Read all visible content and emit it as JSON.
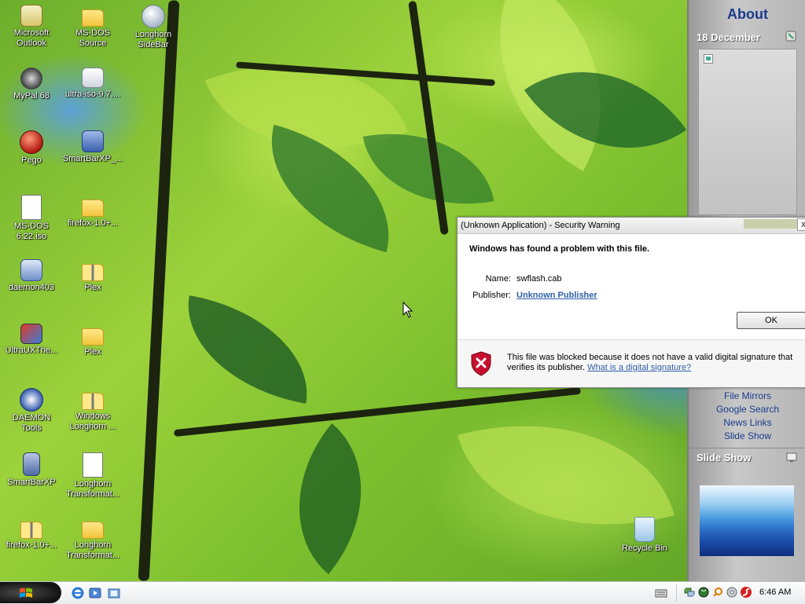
{
  "desktop": {
    "icons": [
      {
        "label": "Microsoft Outlook",
        "line1": "Microsoft",
        "line2": "Outlook",
        "icon": "outlook-icon"
      },
      {
        "label": "MS-DOS Source",
        "line1": "MS-DOS",
        "line2": "Source",
        "icon": "folder-icon"
      },
      {
        "label": "Longhorn SideBar",
        "line1": "Longhorn",
        "line2": "SideBar",
        "icon": "sidebar-icon"
      },
      {
        "label": "MyPal 68",
        "line1": "MyPal 68",
        "line2": "",
        "icon": "mypal-icon"
      },
      {
        "label": "ultra-iso-9.7....",
        "line1": "ultra-iso-9.7....",
        "line2": "",
        "icon": "installer-icon"
      },
      {
        "label": "Pego",
        "line1": "Pego",
        "line2": "",
        "icon": "pego-icon"
      },
      {
        "label": "SmartBarXP_...",
        "line1": "SmartBarXP_...",
        "line2": "",
        "icon": "setup-icon"
      },
      {
        "label": "MS-DOS 6.22.iso",
        "line1": "MS-DOS",
        "line2": "6.22.iso",
        "icon": "iso-icon"
      },
      {
        "label": "firefox-1.0+...",
        "line1": "firefox-1.0+...",
        "line2": "",
        "icon": "folder-icon"
      },
      {
        "label": "daemon403",
        "line1": "daemon403",
        "line2": "",
        "icon": "daemon-setup-icon"
      },
      {
        "label": "Plex",
        "line1": "Plex",
        "line2": "",
        "icon": "zip-folder-icon"
      },
      {
        "label": "UltraUXThe...",
        "line1": "UltraUXThe...",
        "line2": "",
        "icon": "ultraux-icon"
      },
      {
        "label": "Plex",
        "line1": "Plex",
        "line2": "",
        "icon": "folder-icon"
      },
      {
        "label": "DAEMON Tools",
        "line1": "DAEMON",
        "line2": "Tools",
        "icon": "daemon-tools-icon"
      },
      {
        "label": "Windows Longhorn ...",
        "line1": "Windows",
        "line2": "Longhorn ...",
        "icon": "zip-folder-icon"
      },
      {
        "label": "SmartBarXP",
        "line1": "SmartBarXP",
        "line2": "",
        "icon": "smartbar-icon"
      },
      {
        "label": "Longhorn Transformat...",
        "line1": "Longhorn",
        "line2": "Transformat...",
        "icon": "doc-icon"
      },
      {
        "label": "firefox-1.0+...",
        "line1": "firefox-1.0+...",
        "line2": "",
        "icon": "zip-folder-icon"
      },
      {
        "label": "Longhorn Transformat...",
        "line1": "Longhorn",
        "line2": "Transformat...",
        "icon": "folder-icon"
      },
      {
        "label": "Recycle Bin",
        "line1": "Recycle Bin",
        "line2": "",
        "icon": "recycle-bin-icon"
      }
    ]
  },
  "sidebar": {
    "title": "About",
    "date": "18 December",
    "links": [
      "File Mirrors",
      "Google Search",
      "News Links",
      "Slide Show"
    ],
    "slideshow_title": "Slide Show"
  },
  "dialog": {
    "title": "(Unknown Application) - Security Warning",
    "heading": "Windows has found a problem with this file.",
    "name_label": "Name:",
    "name_value": "swflash.cab",
    "publisher_label": "Publisher:",
    "publisher_value": "Unknown Publisher",
    "ok_label": "OK",
    "close_label": "x",
    "footer_text": "This file was blocked because it does not have a valid digital signature that verifies its publisher.",
    "footer_link": "What is a digital signature?"
  },
  "taskbar": {
    "clock": "6:46 AM",
    "quick_launch": [
      "ie-icon",
      "media-icon",
      "explorer-icon"
    ],
    "tray_icons": [
      "network-icon",
      "globe-icon",
      "search-icon",
      "disc-icon",
      "flash-icon"
    ]
  },
  "colors": {
    "link": "#2f5fa8",
    "sidebar_title": "#1a3b8c",
    "error_red": "#c8102e"
  }
}
